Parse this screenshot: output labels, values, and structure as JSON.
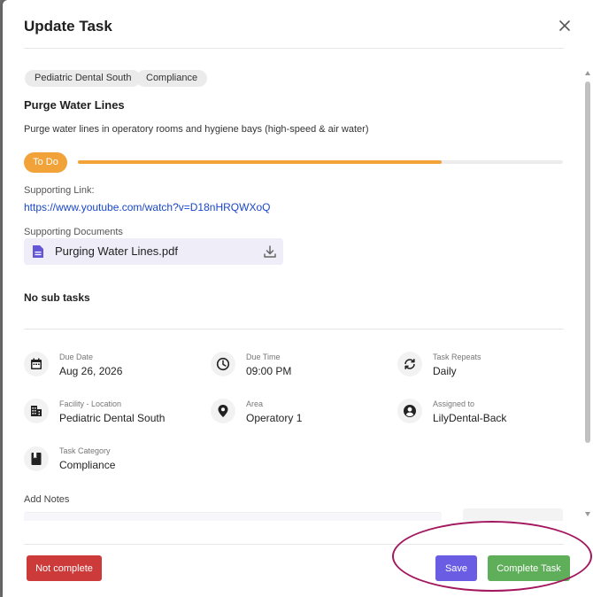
{
  "modal": {
    "title": "Update Task"
  },
  "icons": {
    "close": "close-icon",
    "document": "document-icon",
    "download": "download-icon",
    "calendar": "calendar-icon",
    "clock": "clock-icon",
    "repeat": "repeat-icon",
    "building": "building-icon",
    "location": "location-pin-icon",
    "user": "user-icon",
    "category": "book-icon"
  },
  "tags": [
    "Pediatric Dental South",
    "Compliance"
  ],
  "task": {
    "name": "Purge Water Lines",
    "description": "Purge water lines in operatory rooms and hygiene bays (high-speed & air water)",
    "status": "To Do",
    "progress_percent": 75
  },
  "supporting_link": {
    "label": "Supporting Link:",
    "url": "https://www.youtube.com/watch?v=D18nHRQWXoQ"
  },
  "supporting_documents": {
    "label": "Supporting Documents",
    "files": [
      {
        "name": "Purging Water Lines.pdf"
      }
    ]
  },
  "subtasks": {
    "empty_text": "No sub tasks"
  },
  "details": {
    "due_date": {
      "label": "Due Date",
      "value": "Aug 26, 2026"
    },
    "due_time": {
      "label": "Due Time",
      "value": "09:00 PM"
    },
    "task_repeats": {
      "label": "Task Repeats",
      "value": "Daily"
    },
    "facility": {
      "label": "Facility - Location",
      "value": "Pediatric Dental South"
    },
    "area": {
      "label": "Area",
      "value": "Operatory 1"
    },
    "assigned_to": {
      "label": "Assigned to",
      "value": "LilyDental-Back"
    },
    "task_category": {
      "label": "Task Category",
      "value": "Compliance"
    }
  },
  "notes": {
    "label": "Add Notes"
  },
  "footer": {
    "not_complete_label": "Not complete",
    "save_label": "Save",
    "complete_label": "Complete Task"
  },
  "colors": {
    "status": "#f1a33a",
    "danger": "#cc3a3a",
    "save": "#6a5de3",
    "complete": "#5fae5a",
    "link": "#1a47c9",
    "annotation": "#a3175f"
  }
}
